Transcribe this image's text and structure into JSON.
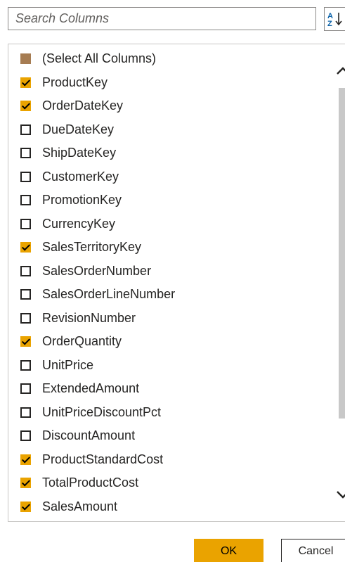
{
  "search": {
    "placeholder": "Search Columns",
    "value": ""
  },
  "sort_icon": "sort-az-icon",
  "columns": {
    "select_all": {
      "label": "(Select All Columns)",
      "state": "partial"
    },
    "items": [
      {
        "label": "ProductKey",
        "checked": true
      },
      {
        "label": "OrderDateKey",
        "checked": true
      },
      {
        "label": "DueDateKey",
        "checked": false
      },
      {
        "label": "ShipDateKey",
        "checked": false
      },
      {
        "label": "CustomerKey",
        "checked": false
      },
      {
        "label": "PromotionKey",
        "checked": false
      },
      {
        "label": "CurrencyKey",
        "checked": false
      },
      {
        "label": "SalesTerritoryKey",
        "checked": true
      },
      {
        "label": "SalesOrderNumber",
        "checked": false
      },
      {
        "label": "SalesOrderLineNumber",
        "checked": false
      },
      {
        "label": "RevisionNumber",
        "checked": false
      },
      {
        "label": "OrderQuantity",
        "checked": true
      },
      {
        "label": "UnitPrice",
        "checked": false
      },
      {
        "label": "ExtendedAmount",
        "checked": false
      },
      {
        "label": "UnitPriceDiscountPct",
        "checked": false
      },
      {
        "label": "DiscountAmount",
        "checked": false
      },
      {
        "label": "ProductStandardCost",
        "checked": true
      },
      {
        "label": "TotalProductCost",
        "checked": true
      },
      {
        "label": "SalesAmount",
        "checked": true
      }
    ]
  },
  "buttons": {
    "ok_label": "OK",
    "cancel_label": "Cancel"
  },
  "colors": {
    "accent": "#eaa300",
    "partial": "#a67c52",
    "scroll_thumb": "#c8c8c8"
  }
}
